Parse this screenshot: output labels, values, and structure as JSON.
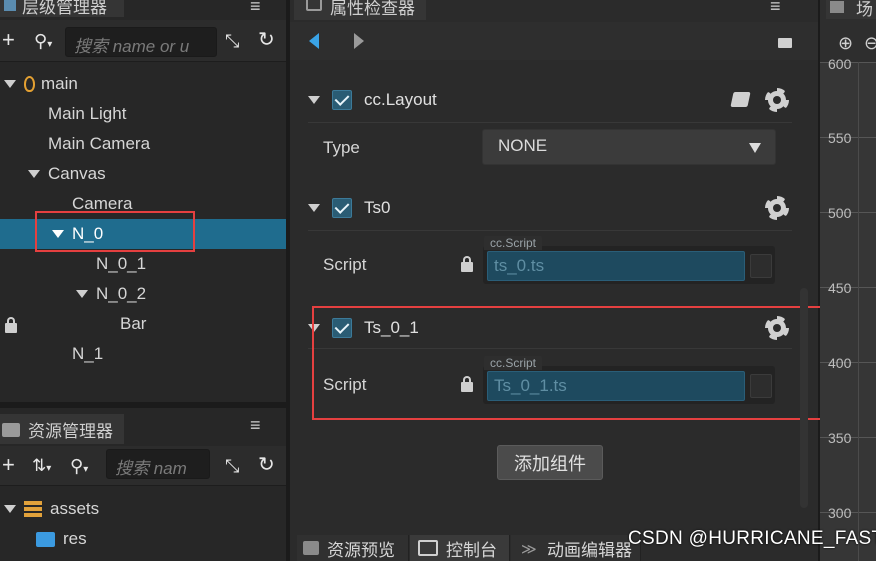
{
  "hierarchy": {
    "tab_title": "层级管理器",
    "search_placeholder": "搜索 name or u",
    "nodes": [
      {
        "label": "main"
      },
      {
        "label": "Main Light"
      },
      {
        "label": "Main Camera"
      },
      {
        "label": "Canvas"
      },
      {
        "label": "Camera"
      },
      {
        "label": "N_0"
      },
      {
        "label": "N_0_1"
      },
      {
        "label": "N_0_2"
      },
      {
        "label": "Bar"
      },
      {
        "label": "N_1"
      }
    ]
  },
  "assets": {
    "tab_title": "资源管理器",
    "search_placeholder": "搜索 nam",
    "items": [
      {
        "label": "assets"
      },
      {
        "label": "res"
      }
    ]
  },
  "inspector": {
    "tab_title": "属性检查器",
    "sections": [
      {
        "title": "cc.Layout",
        "prop_label": "Type",
        "prop_value": "NONE"
      },
      {
        "title": "Ts0",
        "prop_label": "Script",
        "script_type": "cc.Script",
        "script_value": "ts_0.ts"
      },
      {
        "title": "Ts_0_1",
        "prop_label": "Script",
        "script_type": "cc.Script",
        "script_value": "Ts_0_1.ts"
      }
    ],
    "add_component_label": "添加组件"
  },
  "bottom_tabs": [
    {
      "label": "资源预览"
    },
    {
      "label": "控制台"
    },
    {
      "label": "动画编辑器"
    }
  ],
  "scene": {
    "tab_title": "场",
    "ruler": [
      "600",
      "550",
      "500",
      "450",
      "400",
      "350",
      "300"
    ]
  },
  "watermark": "CSDN @HURRICANE_FAST",
  "colors": {
    "selection": "#1f6c8e",
    "highlight_box": "#e54040",
    "checkbox": "#2a5c74"
  }
}
